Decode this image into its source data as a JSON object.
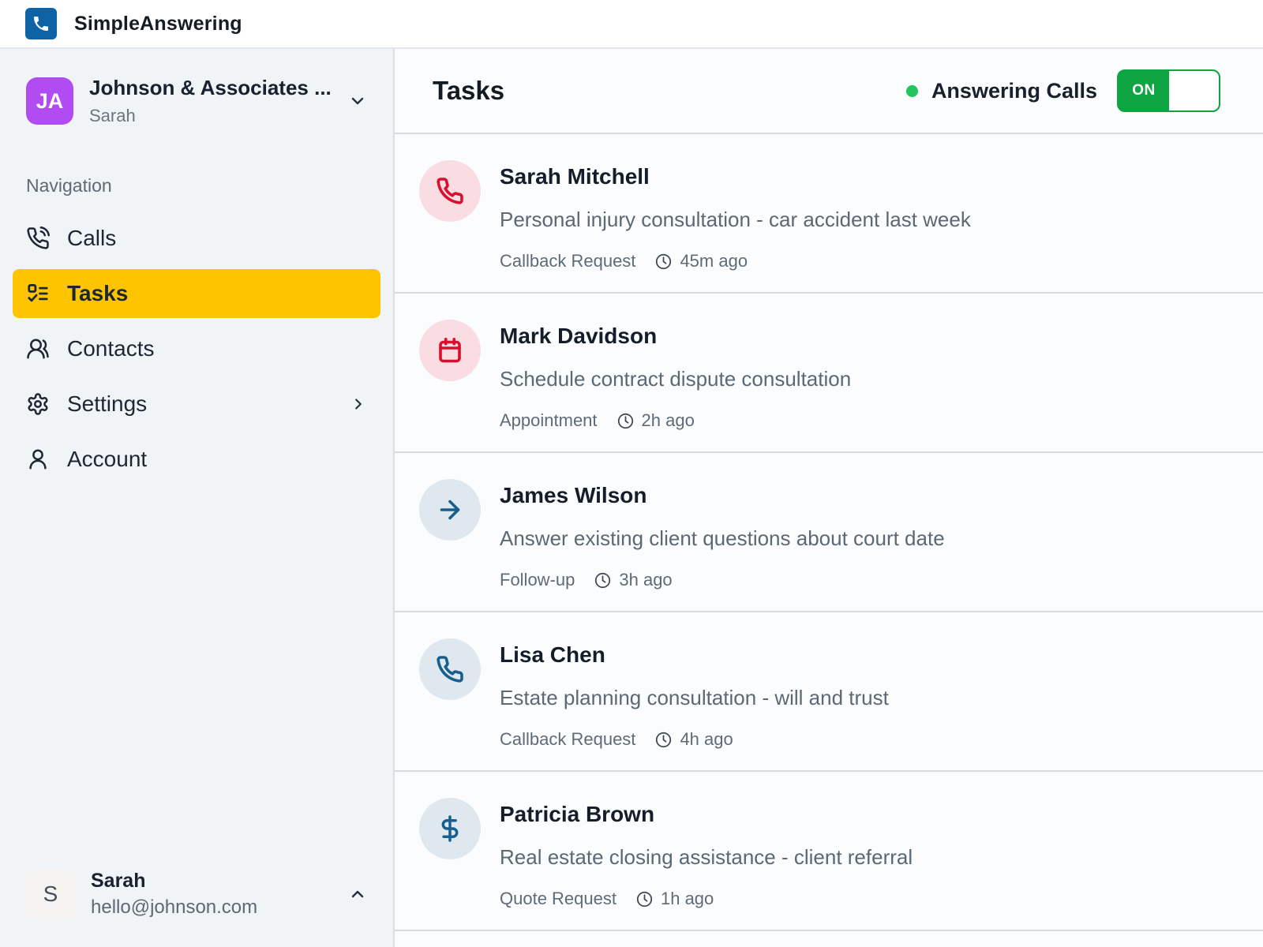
{
  "app": {
    "title": "SimpleAnswering",
    "logo_icon": "phone-icon"
  },
  "sidebar": {
    "org": {
      "initials": "JA",
      "name": "Johnson & Associates ...",
      "subtitle": "Sarah",
      "chevron_icon": "chevron-down-icon"
    },
    "nav_label": "Navigation",
    "items": [
      {
        "label": "Calls",
        "icon": "phone-call-icon",
        "active": false
      },
      {
        "label": "Tasks",
        "icon": "checklist-icon",
        "active": true
      },
      {
        "label": "Contacts",
        "icon": "contacts-icon",
        "active": false
      },
      {
        "label": "Settings",
        "icon": "gear-icon",
        "active": false,
        "trailing_icon": "chevron-right-icon"
      },
      {
        "label": "Account",
        "icon": "person-icon",
        "active": false
      }
    ],
    "user": {
      "initial": "S",
      "name": "Sarah",
      "email": "hello@johnson.com",
      "chevron_icon": "chevron-up-icon"
    }
  },
  "main": {
    "title": "Tasks",
    "status": {
      "label": "Answering Calls",
      "dot_color": "#22c55e",
      "toggle_label": "ON",
      "toggle_state": "on"
    },
    "tasks": [
      {
        "name": "Sarah Mitchell",
        "description": "Personal injury consultation - car accident last week",
        "type": "Callback Request",
        "time": "45m ago",
        "icon": "phone-icon",
        "tone": "red"
      },
      {
        "name": "Mark Davidson",
        "description": "Schedule contract dispute consultation",
        "type": "Appointment",
        "time": "2h ago",
        "icon": "calendar-icon",
        "tone": "red"
      },
      {
        "name": "James Wilson",
        "description": "Answer existing client questions about court date",
        "type": "Follow-up",
        "time": "3h ago",
        "icon": "arrow-right-icon",
        "tone": "blue"
      },
      {
        "name": "Lisa Chen",
        "description": "Estate planning consultation - will and trust",
        "type": "Callback Request",
        "time": "4h ago",
        "icon": "phone-icon",
        "tone": "blue"
      },
      {
        "name": "Patricia Brown",
        "description": "Real estate closing assistance - client referral",
        "type": "Quote Request",
        "time": "1h ago",
        "icon": "dollar-icon",
        "tone": "blue"
      }
    ]
  },
  "colors": {
    "accent_yellow": "#ffc400",
    "toggle_green": "#0ea441",
    "status_green": "#22c55e",
    "logo_blue": "#0d63a6",
    "org_purple": "#b14cf2",
    "task_red": "#d90f2e",
    "task_red_bg": "#f9dde3",
    "task_blue": "#175f8f",
    "task_blue_bg": "#dfe8ef",
    "sidebar_bg": "#f0f4f7"
  }
}
